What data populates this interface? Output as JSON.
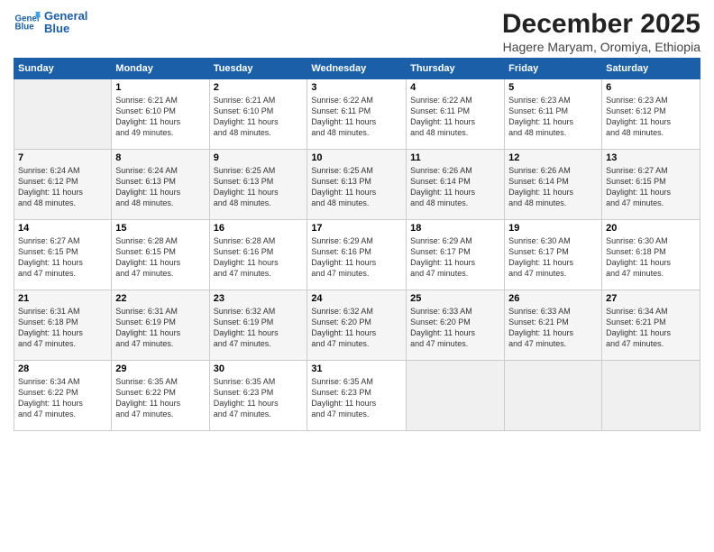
{
  "logo": {
    "line1": "General",
    "line2": "Blue"
  },
  "title": "December 2025",
  "subtitle": "Hagere Maryam, Oromiya, Ethiopia",
  "days_header": [
    "Sunday",
    "Monday",
    "Tuesday",
    "Wednesday",
    "Thursday",
    "Friday",
    "Saturday"
  ],
  "weeks": [
    [
      {
        "day": "",
        "info": ""
      },
      {
        "day": "1",
        "info": "Sunrise: 6:21 AM\nSunset: 6:10 PM\nDaylight: 11 hours\nand 49 minutes."
      },
      {
        "day": "2",
        "info": "Sunrise: 6:21 AM\nSunset: 6:10 PM\nDaylight: 11 hours\nand 48 minutes."
      },
      {
        "day": "3",
        "info": "Sunrise: 6:22 AM\nSunset: 6:11 PM\nDaylight: 11 hours\nand 48 minutes."
      },
      {
        "day": "4",
        "info": "Sunrise: 6:22 AM\nSunset: 6:11 PM\nDaylight: 11 hours\nand 48 minutes."
      },
      {
        "day": "5",
        "info": "Sunrise: 6:23 AM\nSunset: 6:11 PM\nDaylight: 11 hours\nand 48 minutes."
      },
      {
        "day": "6",
        "info": "Sunrise: 6:23 AM\nSunset: 6:12 PM\nDaylight: 11 hours\nand 48 minutes."
      }
    ],
    [
      {
        "day": "7",
        "info": "Sunrise: 6:24 AM\nSunset: 6:12 PM\nDaylight: 11 hours\nand 48 minutes."
      },
      {
        "day": "8",
        "info": "Sunrise: 6:24 AM\nSunset: 6:13 PM\nDaylight: 11 hours\nand 48 minutes."
      },
      {
        "day": "9",
        "info": "Sunrise: 6:25 AM\nSunset: 6:13 PM\nDaylight: 11 hours\nand 48 minutes."
      },
      {
        "day": "10",
        "info": "Sunrise: 6:25 AM\nSunset: 6:13 PM\nDaylight: 11 hours\nand 48 minutes."
      },
      {
        "day": "11",
        "info": "Sunrise: 6:26 AM\nSunset: 6:14 PM\nDaylight: 11 hours\nand 48 minutes."
      },
      {
        "day": "12",
        "info": "Sunrise: 6:26 AM\nSunset: 6:14 PM\nDaylight: 11 hours\nand 48 minutes."
      },
      {
        "day": "13",
        "info": "Sunrise: 6:27 AM\nSunset: 6:15 PM\nDaylight: 11 hours\nand 47 minutes."
      }
    ],
    [
      {
        "day": "14",
        "info": "Sunrise: 6:27 AM\nSunset: 6:15 PM\nDaylight: 11 hours\nand 47 minutes."
      },
      {
        "day": "15",
        "info": "Sunrise: 6:28 AM\nSunset: 6:15 PM\nDaylight: 11 hours\nand 47 minutes."
      },
      {
        "day": "16",
        "info": "Sunrise: 6:28 AM\nSunset: 6:16 PM\nDaylight: 11 hours\nand 47 minutes."
      },
      {
        "day": "17",
        "info": "Sunrise: 6:29 AM\nSunset: 6:16 PM\nDaylight: 11 hours\nand 47 minutes."
      },
      {
        "day": "18",
        "info": "Sunrise: 6:29 AM\nSunset: 6:17 PM\nDaylight: 11 hours\nand 47 minutes."
      },
      {
        "day": "19",
        "info": "Sunrise: 6:30 AM\nSunset: 6:17 PM\nDaylight: 11 hours\nand 47 minutes."
      },
      {
        "day": "20",
        "info": "Sunrise: 6:30 AM\nSunset: 6:18 PM\nDaylight: 11 hours\nand 47 minutes."
      }
    ],
    [
      {
        "day": "21",
        "info": "Sunrise: 6:31 AM\nSunset: 6:18 PM\nDaylight: 11 hours\nand 47 minutes."
      },
      {
        "day": "22",
        "info": "Sunrise: 6:31 AM\nSunset: 6:19 PM\nDaylight: 11 hours\nand 47 minutes."
      },
      {
        "day": "23",
        "info": "Sunrise: 6:32 AM\nSunset: 6:19 PM\nDaylight: 11 hours\nand 47 minutes."
      },
      {
        "day": "24",
        "info": "Sunrise: 6:32 AM\nSunset: 6:20 PM\nDaylight: 11 hours\nand 47 minutes."
      },
      {
        "day": "25",
        "info": "Sunrise: 6:33 AM\nSunset: 6:20 PM\nDaylight: 11 hours\nand 47 minutes."
      },
      {
        "day": "26",
        "info": "Sunrise: 6:33 AM\nSunset: 6:21 PM\nDaylight: 11 hours\nand 47 minutes."
      },
      {
        "day": "27",
        "info": "Sunrise: 6:34 AM\nSunset: 6:21 PM\nDaylight: 11 hours\nand 47 minutes."
      }
    ],
    [
      {
        "day": "28",
        "info": "Sunrise: 6:34 AM\nSunset: 6:22 PM\nDaylight: 11 hours\nand 47 minutes."
      },
      {
        "day": "29",
        "info": "Sunrise: 6:35 AM\nSunset: 6:22 PM\nDaylight: 11 hours\nand 47 minutes."
      },
      {
        "day": "30",
        "info": "Sunrise: 6:35 AM\nSunset: 6:23 PM\nDaylight: 11 hours\nand 47 minutes."
      },
      {
        "day": "31",
        "info": "Sunrise: 6:35 AM\nSunset: 6:23 PM\nDaylight: 11 hours\nand 47 minutes."
      },
      {
        "day": "",
        "info": ""
      },
      {
        "day": "",
        "info": ""
      },
      {
        "day": "",
        "info": ""
      }
    ]
  ]
}
